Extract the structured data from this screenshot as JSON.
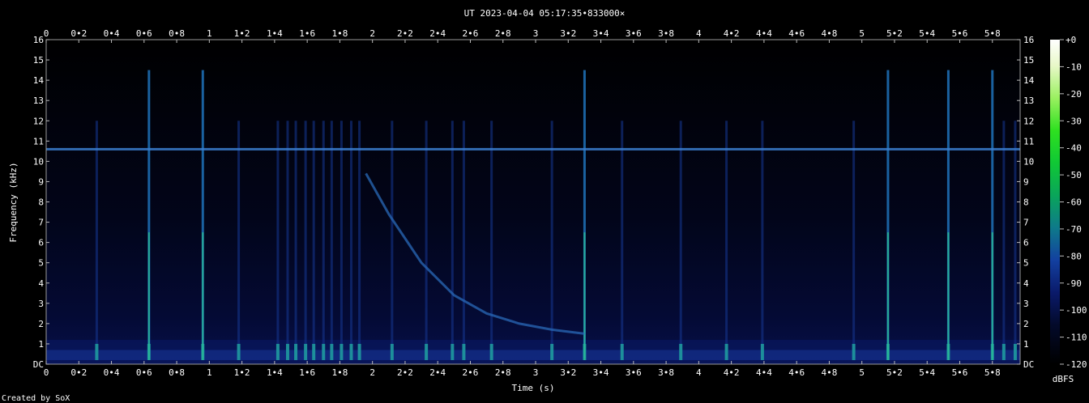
{
  "chart_data": {
    "type": "heatmap",
    "title": "UT 2023-04-04 05:17:35•833000×",
    "xlabel": "Time (s)",
    "ylabel": "Frequency (kHz)",
    "xlim": [
      0,
      5.97
    ],
    "ylim": [
      0,
      16
    ],
    "x_ticks": [
      "0",
      "0•2",
      "0•4",
      "0•6",
      "0•8",
      "1",
      "1•2",
      "1•4",
      "1•6",
      "1•8",
      "2",
      "2•2",
      "2•4",
      "2•6",
      "2•8",
      "3",
      "3•2",
      "3•4",
      "3•6",
      "3•8",
      "4",
      "4•2",
      "4•4",
      "4•6",
      "4•8",
      "5",
      "5•2",
      "5•4",
      "5•6",
      "5•8"
    ],
    "y_ticks": [
      "DC",
      "1",
      "2",
      "3",
      "4",
      "5",
      "6",
      "7",
      "8",
      "9",
      "10",
      "11",
      "12",
      "13",
      "14",
      "15",
      "16"
    ],
    "colorbar": {
      "label": "dBFS",
      "ticks": [
        "+0",
        "-10",
        "-20",
        "-30",
        "-40",
        "-50",
        "-60",
        "-70",
        "-80",
        "-90",
        "-100",
        "-110",
        "-120"
      ],
      "range": [
        -120,
        0
      ]
    },
    "features": {
      "tone_khz": 10.6,
      "sferic_times_s": [
        0.31,
        0.63,
        0.96,
        1.18,
        1.42,
        1.48,
        1.53,
        1.59,
        1.64,
        1.7,
        1.75,
        1.81,
        1.87,
        1.92,
        2.12,
        2.33,
        2.49,
        2.56,
        2.73,
        3.1,
        3.3,
        3.53,
        3.89,
        4.17,
        4.39,
        4.95,
        5.16,
        5.53,
        5.8,
        5.87,
        5.94
      ],
      "strong_sferics_s": [
        0.63,
        0.96,
        3.3,
        5.16,
        5.53,
        5.8
      ],
      "whistler_curve": {
        "x": [
          1.96,
          2.1,
          2.3,
          2.5,
          2.7,
          2.9,
          3.1,
          3.3
        ],
        "y": [
          9.4,
          7.4,
          5.0,
          3.4,
          2.5,
          2.0,
          1.7,
          1.5
        ]
      }
    },
    "grid": false
  },
  "footer": {
    "credit": "Created by SoX"
  }
}
